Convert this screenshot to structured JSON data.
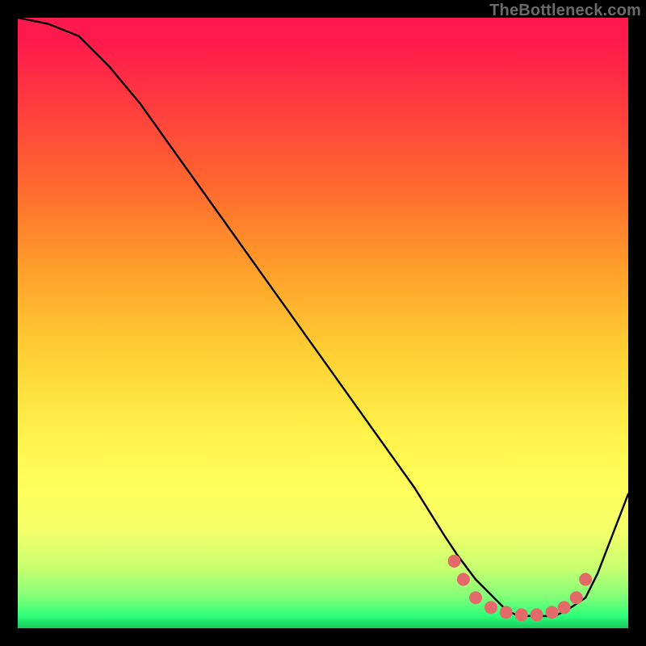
{
  "watermark": "TheBottleneck.com",
  "chart_data": {
    "type": "line",
    "title": "",
    "xlabel": "",
    "ylabel": "",
    "x_range": [
      0,
      100
    ],
    "y_range": [
      0,
      100
    ],
    "grid": false,
    "series": [
      {
        "name": "bottleneck-curve",
        "x": [
          0,
          5,
          10,
          15,
          20,
          25,
          30,
          35,
          40,
          45,
          50,
          55,
          60,
          65,
          70,
          72,
          75,
          78,
          80,
          82,
          85,
          88,
          90,
          93,
          95,
          100
        ],
        "y": [
          100,
          99,
          97,
          92,
          86,
          79,
          72,
          65,
          58,
          51,
          44,
          37,
          30,
          23,
          15,
          12,
          8,
          5,
          3,
          2,
          2,
          2,
          3,
          5,
          9,
          22
        ]
      }
    ],
    "markers": {
      "name": "flat-zone-dots",
      "x": [
        71.5,
        73,
        75,
        77.5,
        80,
        82.5,
        85,
        87.5,
        89.5,
        91.5,
        93
      ],
      "y": [
        11,
        8,
        5,
        3.4,
        2.6,
        2.2,
        2.2,
        2.6,
        3.4,
        5,
        8
      ],
      "color": "#e46a6a",
      "radius": 8
    },
    "colors": {
      "curve": "#000000",
      "marker": "#e46a6a",
      "gradient_top": "#ff1a4d",
      "gradient_bottom": "#17c95b"
    }
  }
}
